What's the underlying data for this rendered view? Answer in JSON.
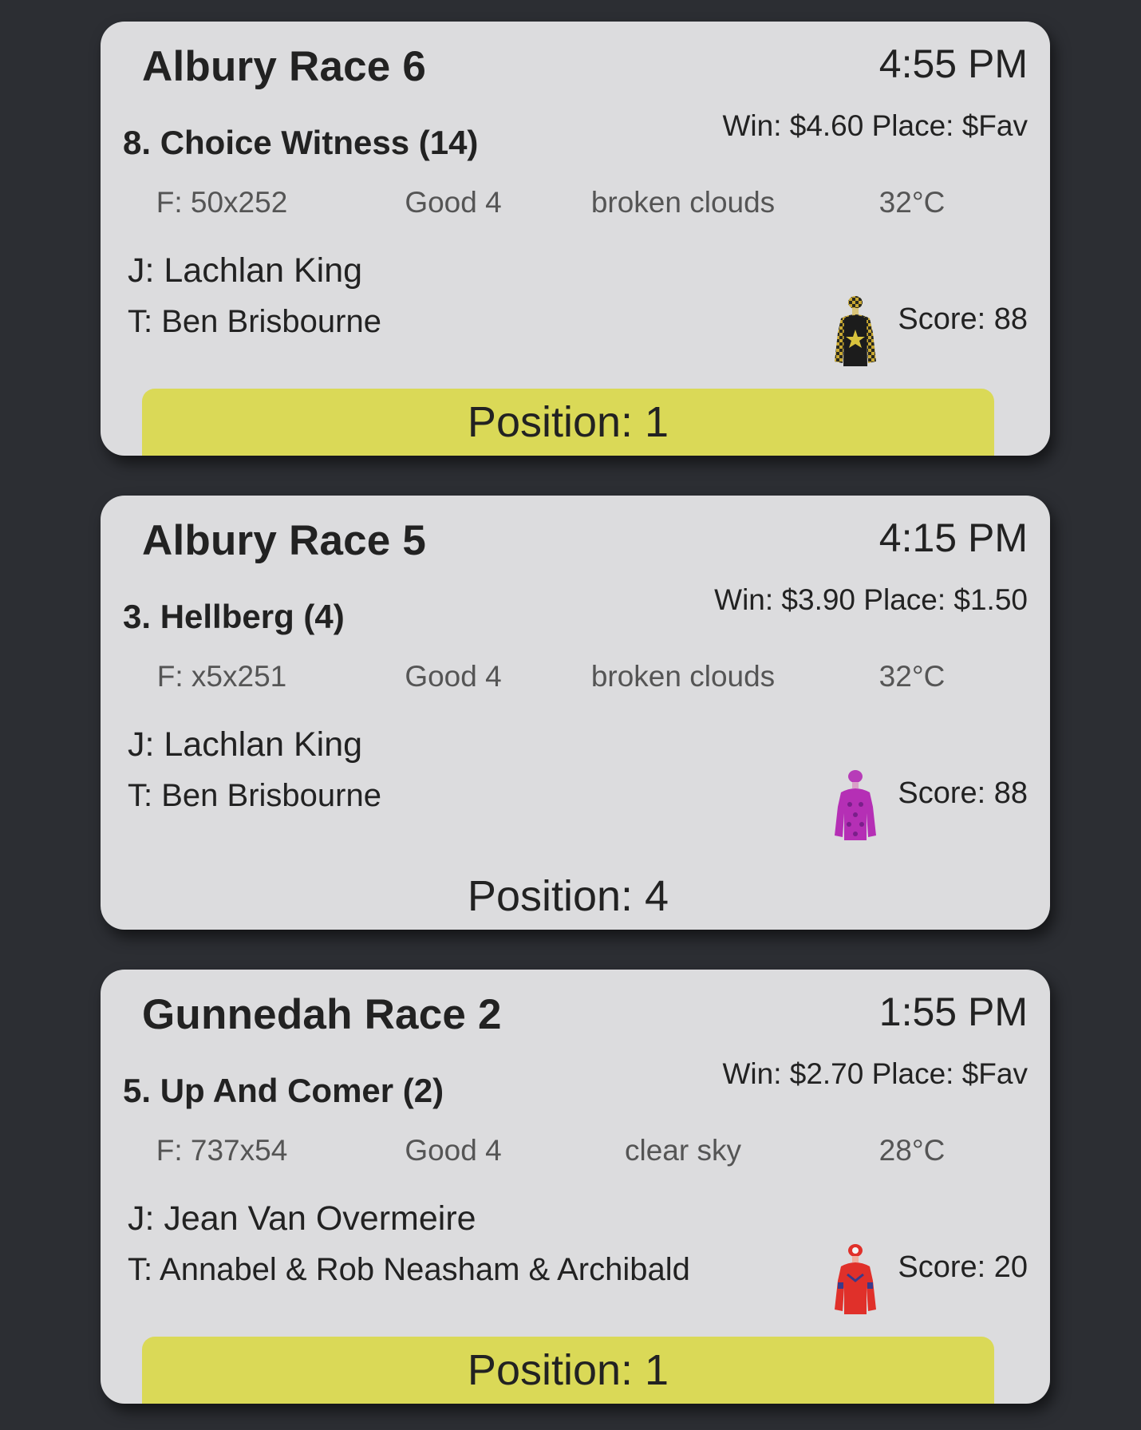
{
  "colors": {
    "background": "#2c2e33",
    "card": "#dcdcde",
    "position_highlight": "#dad957"
  },
  "cards": [
    {
      "race": "Albury Race 6",
      "time": "4:55 PM",
      "runner": "8. Choice Witness (14)",
      "odds": "Win: $4.60 Place: $Fav",
      "form": "F: 50x252",
      "track": "Good 4",
      "weather": "broken clouds",
      "temperature": "32°C",
      "jockey": "J: Lachlan King",
      "trainer": "T: Ben Brisbourne",
      "score": "Score: 88",
      "position": "Position: 1",
      "silk_icon": "jockey-silks-black-gold-star-icon"
    },
    {
      "race": "Albury Race 5",
      "time": "4:15 PM",
      "runner": "3. Hellberg (4)",
      "odds": "Win: $3.90 Place: $1.50",
      "form": "F: x5x251",
      "track": "Good 4",
      "weather": "broken clouds",
      "temperature": "32°C",
      "jockey": "J: Lachlan King",
      "trainer": "T: Ben Brisbourne",
      "score": "Score: 88",
      "position": "Position: 4",
      "silk_icon": "jockey-silks-purple-icon"
    },
    {
      "race": "Gunnedah Race 2",
      "time": "1:55 PM",
      "runner": "5. Up And Comer (2)",
      "odds": "Win: $2.70 Place: $Fav",
      "form": "F: 737x54",
      "track": "Good 4",
      "weather": "clear sky",
      "temperature": "28°C",
      "jockey": "J: Jean Van Overmeire",
      "trainer": "T: Annabel & Rob Neasham & Archibald",
      "score": "Score: 20",
      "position": "Position: 1",
      "silk_icon": "jockey-silks-red-icon"
    }
  ]
}
